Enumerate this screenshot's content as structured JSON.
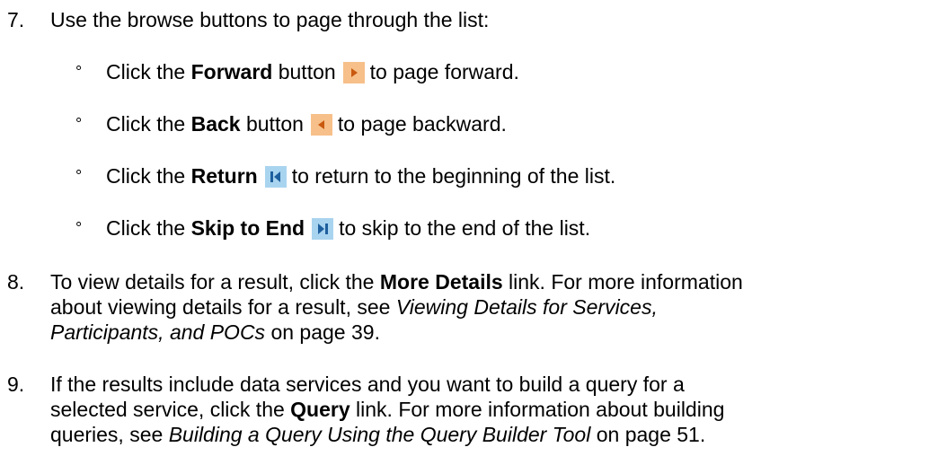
{
  "step7": {
    "number": "7.",
    "intro": "Use the browse buttons to page through the list:",
    "bullet": "°",
    "items": [
      {
        "pre": "Click the ",
        "bold": "Forward",
        "post": " button",
        "after": "to page forward.",
        "icon": "forward-icon",
        "icon_color": "#f7c08a"
      },
      {
        "pre": "Click the ",
        "bold": "Back",
        "post": " button",
        "after": "to page backward.",
        "icon": "back-icon",
        "icon_color": "#f7c08a"
      },
      {
        "pre": "Click the ",
        "bold": "Return",
        "post": "",
        "after": "to return to the beginning of the list.",
        "icon": "return-to-start-icon",
        "icon_color": "#a9d4ef"
      },
      {
        "pre": "Click the ",
        "bold": "Skip to End",
        "post": "",
        "after": "to skip to the end of the list.",
        "icon": "skip-to-end-icon",
        "icon_color": "#a9d4ef"
      }
    ]
  },
  "step8": {
    "number": "8.",
    "l1_pre": "To view details for a result, click the ",
    "l1_bold": "More Details",
    "l1_post": " link. For more information",
    "l2_pre": "about viewing details for a result, see ",
    "l2_italic": "Viewing Details for Services,",
    "l3_italic": "Participants, and POCs",
    "l3_post": " on page 39."
  },
  "step9": {
    "number": "9.",
    "l1": "If the results include data services and you want to build a query for a",
    "l2_pre": "selected service, click the ",
    "l2_bold": "Query",
    "l2_post": " link. For more information about building",
    "l3_pre": "queries, see ",
    "l3_italic": "Building a Query Using the Query Builder Tool",
    "l3_post": " on page 51."
  }
}
